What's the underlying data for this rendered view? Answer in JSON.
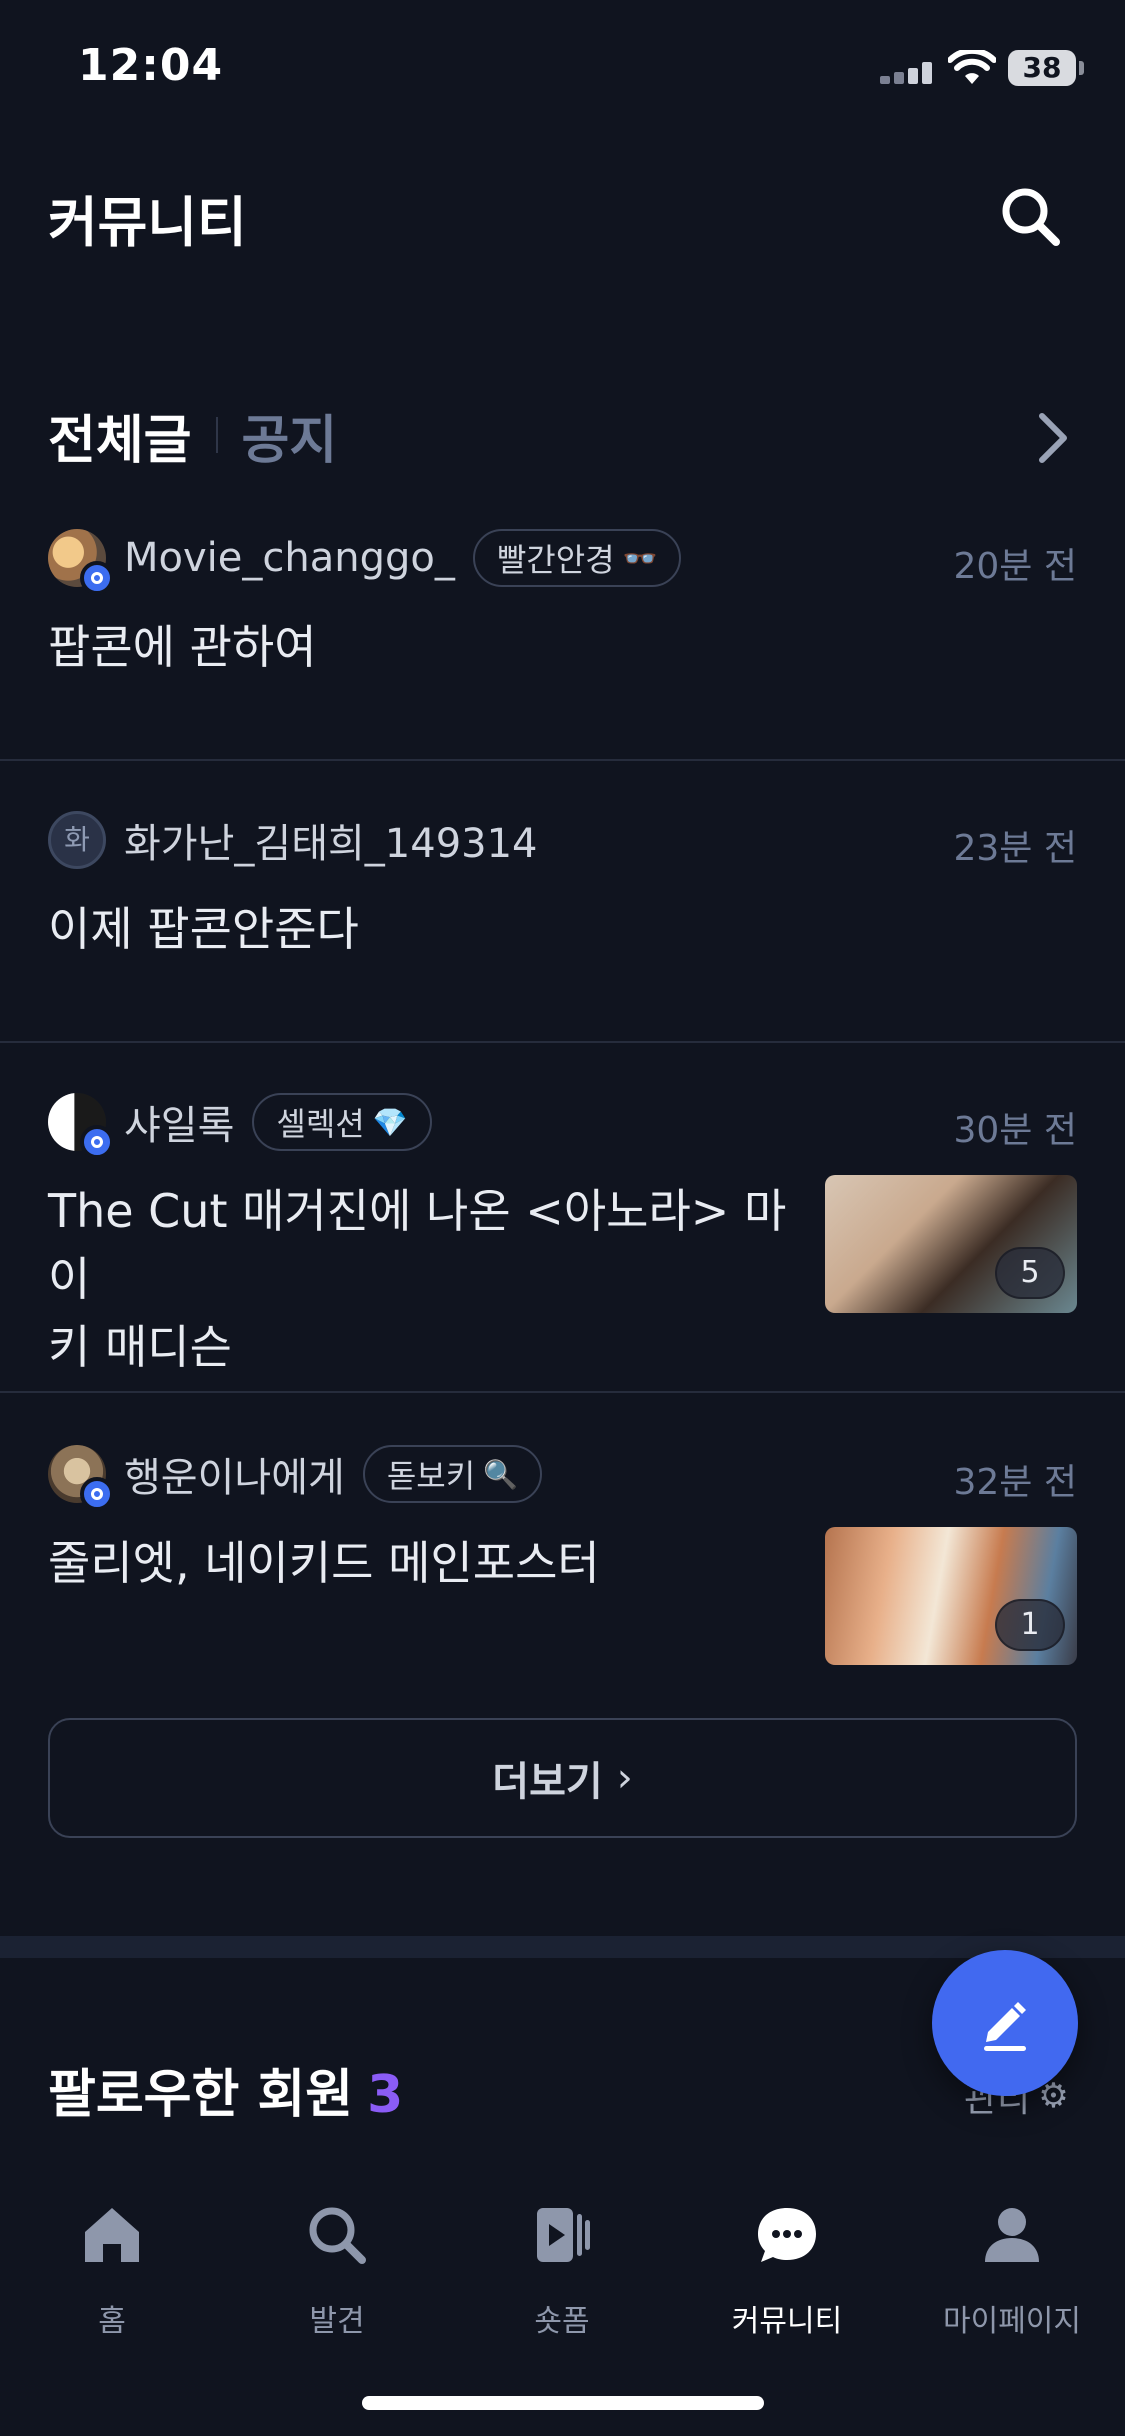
{
  "status_bar": {
    "time": "12:04",
    "battery": "38"
  },
  "header": {
    "title": "커뮤니티"
  },
  "tabs": [
    {
      "label": "전체글",
      "active": true
    },
    {
      "label": "공지",
      "active": false
    }
  ],
  "posts": [
    {
      "username": "Movie_changgo_",
      "tag": "빨간안경",
      "tag_emoji": "👓",
      "time": "20분 전",
      "title": "팝콘에 관하여",
      "avatar_letter": "",
      "verified": true,
      "thumbnail_count": null
    },
    {
      "username": "화가난_김태희_149314",
      "tag": "",
      "tag_emoji": "",
      "time": "23분 전",
      "title": "이제 팝콘안준다",
      "avatar_letter": "화",
      "verified": false,
      "thumbnail_count": null
    },
    {
      "username": "샤일록",
      "tag": "셀렉션",
      "tag_emoji": "💎",
      "time": "30분 전",
      "title_line1": "The Cut 매거진에 나온 <아노라> 마이",
      "title_line2": "키 매디슨",
      "avatar_letter": "",
      "verified": true,
      "thumbnail_count": "5"
    },
    {
      "username": "행운이나에게",
      "tag": "돋보키",
      "tag_emoji": "🔍",
      "time": "32분 전",
      "title": "줄리엣, 네이키드 메인포스터",
      "avatar_letter": "",
      "verified": true,
      "thumbnail_count": "1"
    }
  ],
  "more_button": {
    "label": "더보기",
    "chevron": "›"
  },
  "followed": {
    "title": "팔로우한 회원",
    "count": "3",
    "manage_label": "관리",
    "manage_icon": "⚙"
  },
  "bottom_nav": [
    {
      "label": "홈",
      "icon": "home-icon",
      "active": false
    },
    {
      "label": "발견",
      "icon": "search-icon",
      "active": false
    },
    {
      "label": "숏폼",
      "icon": "shortform-icon",
      "active": false
    },
    {
      "label": "커뮤니티",
      "icon": "chat-icon",
      "active": true
    },
    {
      "label": "마이페이지",
      "icon": "person-icon",
      "active": false
    }
  ],
  "colors": {
    "background": "#10141f",
    "accent": "#4169f0",
    "count_purple": "#8b5cf6",
    "muted": "#6d7a96"
  }
}
